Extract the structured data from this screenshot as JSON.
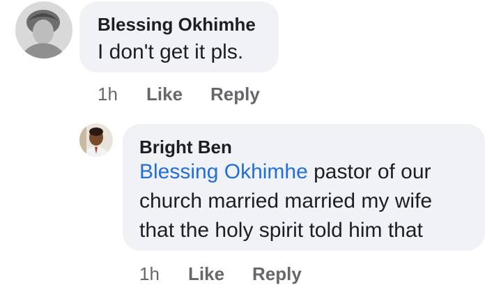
{
  "comments": [
    {
      "author": "Blessing Okhimhe",
      "text": "I don't get it pls.",
      "time": "1h",
      "like_label": "Like",
      "reply_label": "Reply"
    },
    {
      "author": "Bright Ben",
      "mention": "Blessing Okhimhe",
      "lines": [
        " pastor of our",
        "church married married my wife",
        "that the holy spirit told him that"
      ],
      "time": "1h",
      "like_label": "Like",
      "reply_label": "Reply"
    }
  ],
  "colors": {
    "bubble": "#f0f2f5",
    "mention": "#216fdb",
    "meta": "#65676b",
    "text": "#1c1e21"
  },
  "icons": {
    "first_avatar": "user-avatar-icon",
    "second_avatar": "user-avatar-icon"
  }
}
